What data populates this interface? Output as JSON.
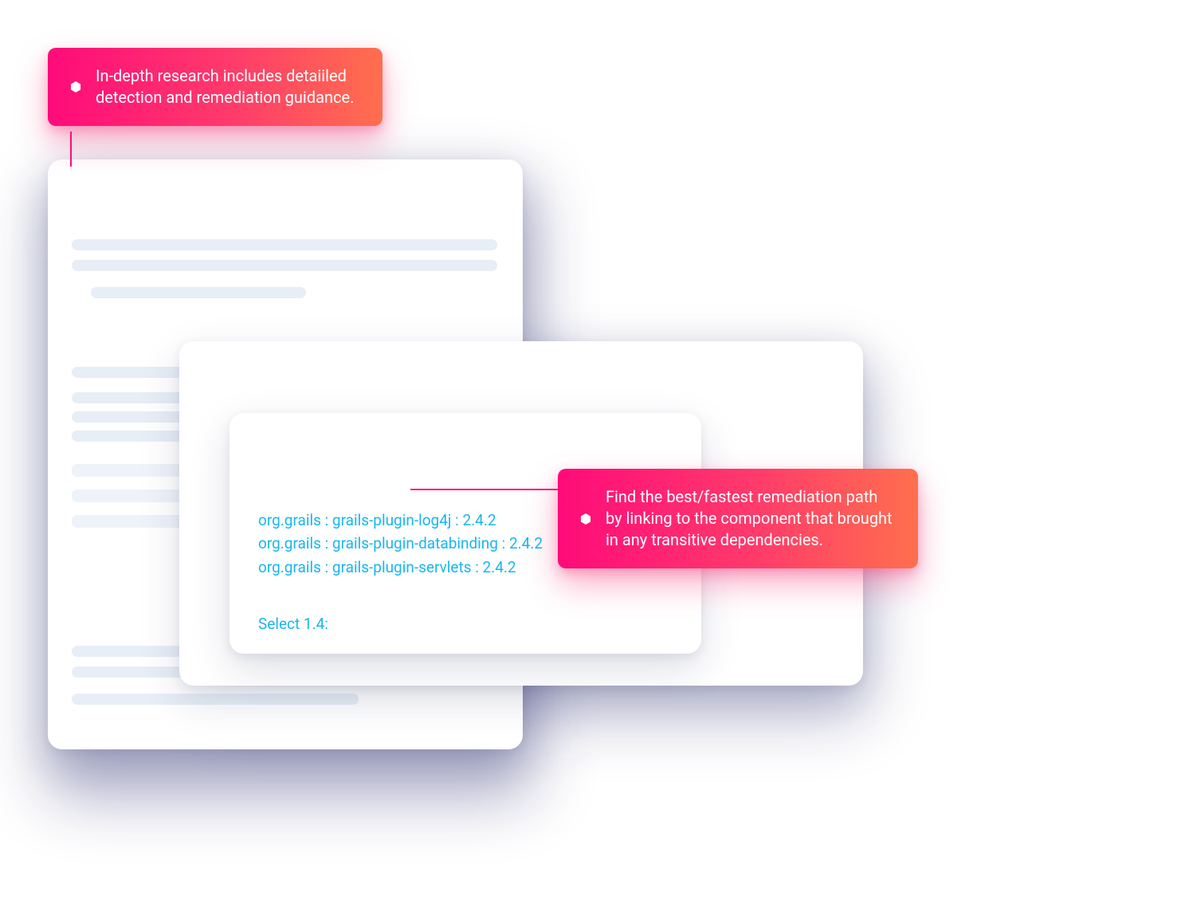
{
  "callouts": {
    "top": "In-depth research includes detaiiled detection and remediation guidance.",
    "right": "Find the best/fastest remediation path by linking to the component that brought in any transitive dependencies."
  },
  "dependencies": [
    "org.grails : grails-plugin-log4j : 2.4.2",
    "org.grails : grails-plugin-databinding : 2.4.2",
    "org.grails : grails-plugin-servlets : 2.4.2"
  ],
  "select_label": "Select 1.4:",
  "colors": {
    "callout_gradient_start": "#ff0b7a",
    "callout_gradient_end": "#ff6f4d",
    "link": "#19b6f0",
    "skeleton": "#e7eef6"
  }
}
